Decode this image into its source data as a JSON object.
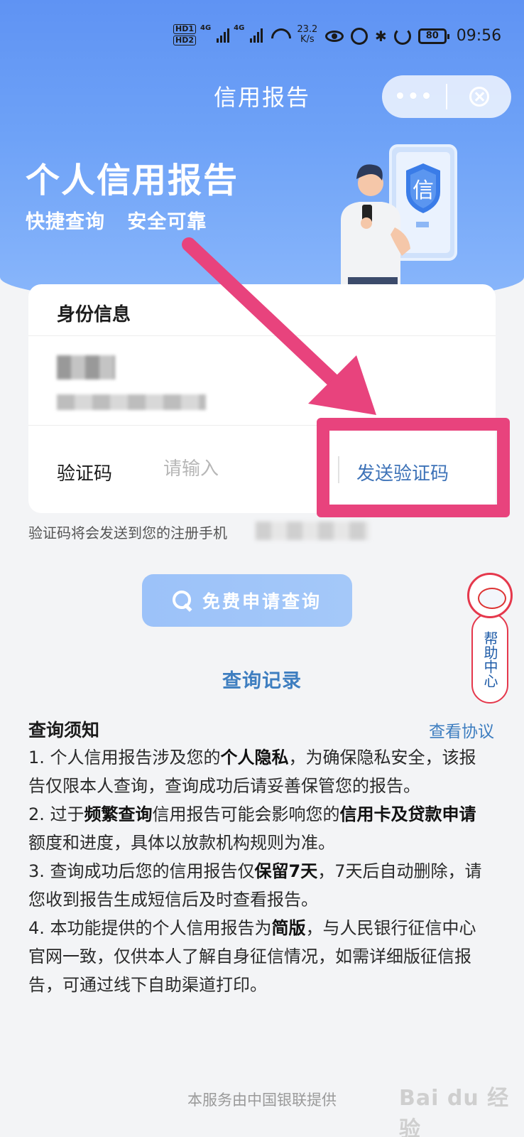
{
  "status_bar": {
    "hd1": "HD1",
    "hd2": "HD2",
    "net1": "4G",
    "net2": "4G",
    "speed_value": "23.2",
    "speed_unit": "K/s",
    "battery": "80",
    "time": "09:56"
  },
  "nav": {
    "title": "信用报告",
    "more_label": "•••"
  },
  "hero": {
    "title": "个人信用报告",
    "subtitle": "快捷查询   安全可靠",
    "badge_char": "信"
  },
  "identity_card": {
    "heading": "身份信息",
    "code_label": "验证码",
    "code_placeholder": "请输入",
    "send_code_label": "发送验证码",
    "hint": "验证码将会发送到您的注册手机"
  },
  "actions": {
    "query_button": "免费申请查询",
    "records_link": "查询记录"
  },
  "help": {
    "label": "帮助中心"
  },
  "notice": {
    "title": "查询须知",
    "agreement_link": "查看协议",
    "items": [
      {
        "a": "1. 个人信用报告涉及您的",
        "b": "个人隐私",
        "c": "，为确保隐私安全，该报告仅限本人查询，查询成功后请妥善保管您的报告。",
        "d": "",
        "e": ""
      },
      {
        "a": "2. 过于",
        "b": "频繁查询",
        "c": "信用报告可能会影响您的",
        "d": "信用卡及贷款申请",
        "e": "额度和进度，具体以放款机构规则为准。"
      },
      {
        "a": "3. 查询成功后您的信用报告仅",
        "b": "保留7天",
        "c": "，7天后自动删除，请您收到报告生成短信后及时查看报告。",
        "d": "",
        "e": ""
      },
      {
        "a": "4. 本功能提供的个人信用报告为",
        "b": "简版",
        "c": "，与人民银行征信中心官网一致，仅供本人了解自身征信情况，如需详细版征信报告，可通过线下自助渠道打印。",
        "d": "",
        "e": ""
      }
    ]
  },
  "footer": {
    "provider": "本服务由中国银联提供",
    "watermark": "Bai du 经验"
  },
  "colors": {
    "hero_blue": "#6ea2f7",
    "link_blue": "#3e7ec0",
    "annotation_pink": "#e8437d"
  }
}
